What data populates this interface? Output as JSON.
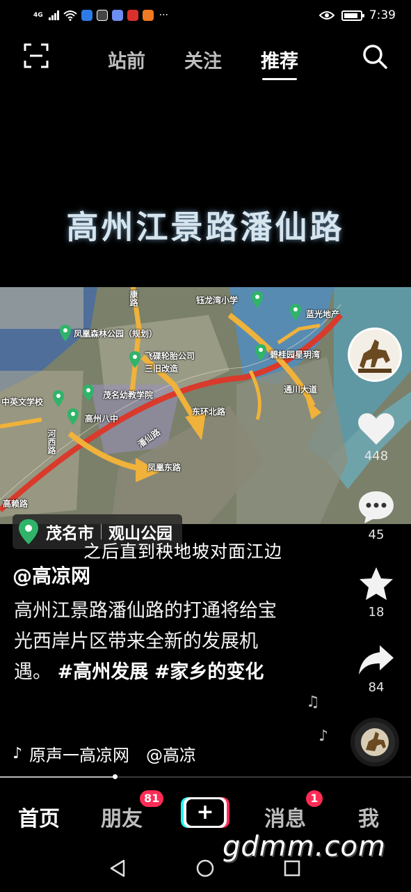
{
  "status_bar": {
    "network": "4G",
    "time": "7:39",
    "battery_level": 0.85
  },
  "top_nav": {
    "tabs": [
      {
        "label": "站前",
        "active": false
      },
      {
        "label": "关注",
        "active": false
      },
      {
        "label": "推荐",
        "active": true
      }
    ]
  },
  "video": {
    "title": "高州江景路潘仙路",
    "subtitle": "之后直到秧地坡对面江边",
    "map_labels": {
      "l1": "钰龙湾小学",
      "l2": "蓝光地产",
      "l3": "凤凰森林公园（规划）",
      "l4": "飞碟轮胎公司",
      "l5": "三旧改造",
      "l6": "碧桂园星玥湾",
      "l7": "茂名幼教学院",
      "l8": "中英文学校",
      "l9": "高州八中",
      "l10": "通川大道",
      "l11": "东环北路",
      "l12": "凤凰东路",
      "l13": "高赖路",
      "r1": "康路",
      "r2": "河西路",
      "r3": "潘仙路"
    }
  },
  "location_tag": {
    "city": "茂名市",
    "place": "观山公园"
  },
  "author": "@高凉网",
  "caption": {
    "text": "高州江景路潘仙路的打通将给宝光西岸片区带来全新的发展机遇。",
    "tag1": "#高州发展",
    "tag2": "#家乡的变化"
  },
  "music": {
    "text": "原声一高凉网　@高凉"
  },
  "actions": {
    "likes": "448",
    "comments": "45",
    "favorites": "18",
    "shares": "84"
  },
  "progress": 0.28,
  "bottom_nav": {
    "home": "首页",
    "friends": "朋友",
    "friends_badge": "81",
    "messages": "消息",
    "messages_badge": "1",
    "me": "我"
  },
  "watermark": "gdmm.com",
  "colors": {
    "accent_red": "#fe2c55",
    "accent_cyan": "#25f4ee",
    "road_red": "#d93a2b",
    "arrow_yellow": "#f0b23a"
  }
}
